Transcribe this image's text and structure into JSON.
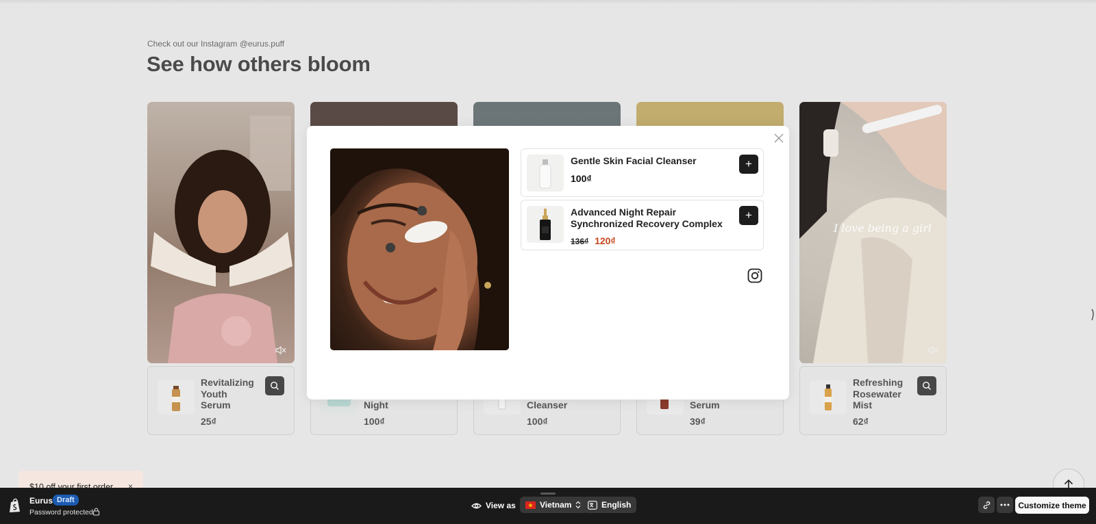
{
  "section": {
    "kicker": "Check out our Instagram @eurus.puff",
    "heading": "See how others bloom"
  },
  "cards": [
    {
      "name_lines": [
        "Revitalizing",
        "Youth",
        "Serum"
      ],
      "price": "25₫"
    },
    {
      "name_lines": [
        "Night"
      ],
      "price": "100₫"
    },
    {
      "name_lines": [
        "Cleanser"
      ],
      "price": "100₫"
    },
    {
      "name_lines": [
        "Serum"
      ],
      "price": "39₫"
    },
    {
      "name_lines": [
        "Refreshing",
        "Rosewater",
        "Mist"
      ],
      "price": "62₫"
    }
  ],
  "overlay_text": "I love being a girl",
  "modal": {
    "products": [
      {
        "title": "Gentle Skin Facial Cleanser",
        "price": "100₫",
        "add_label": "+"
      },
      {
        "title": "Advanced Night Repair Synchronized Recovery Complex",
        "compare_price": "136₫",
        "sale_price": "120₫",
        "add_label": "+"
      }
    ],
    "close_label": "×"
  },
  "promo": {
    "text": "$10 off your first order",
    "close": "×"
  },
  "admin_bar": {
    "store_name": "Eurus",
    "badge": "Draft",
    "status": "Password protected",
    "view_as": "View as",
    "country": "Vietnam",
    "language": "English",
    "customize": "Customize theme"
  },
  "colors": {
    "sale": "#c4451b",
    "draft_badge": "#1c5bb0",
    "admin_bg": "#1a1a1a"
  }
}
